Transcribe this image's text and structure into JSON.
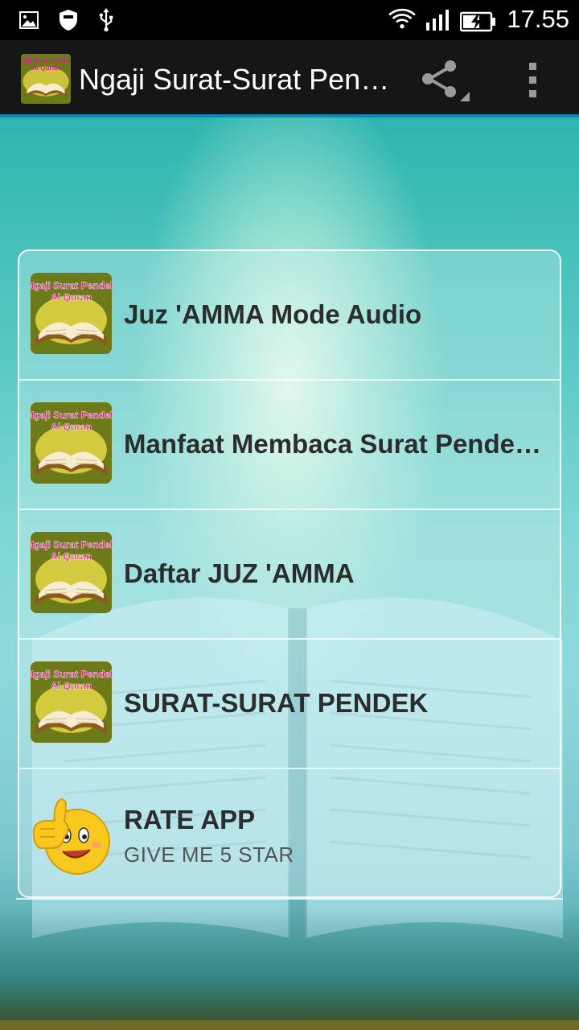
{
  "status_bar": {
    "time": "17.55",
    "icons": [
      "gallery-notification-icon",
      "shield-icon",
      "usb-icon",
      "wifi-icon",
      "signal-icon",
      "battery-charging-icon"
    ]
  },
  "action_bar": {
    "title": "Ngaji Surat-Surat Pendek Al Quran",
    "icons": [
      "app-logo-icon",
      "share-icon",
      "overflow-menu-icon"
    ]
  },
  "thumb_text": {
    "line1": "Ngaji Surat Pendek",
    "line2": "Al Quran"
  },
  "menu": {
    "items": [
      {
        "label": "Juz 'AMMA Mode Audio",
        "icon": "app-book-icon"
      },
      {
        "label": "Manfaat Membaca Surat Pendek Al Quran",
        "icon": "app-book-icon"
      },
      {
        "label": "Daftar JUZ 'AMMA",
        "icon": "app-book-icon"
      },
      {
        "label": "SURAT-SURAT PENDEK",
        "icon": "app-book-icon"
      },
      {
        "label": "RATE APP",
        "sublabel": "GIVE ME 5 STAR",
        "icon": "thumbs-up-smiley-icon"
      }
    ]
  },
  "colors": {
    "action_bar_bg": "#161616",
    "accent": "#0f86b7",
    "thumb_bg": "#6d7a19",
    "thumb_title_text": "#e0189a"
  }
}
